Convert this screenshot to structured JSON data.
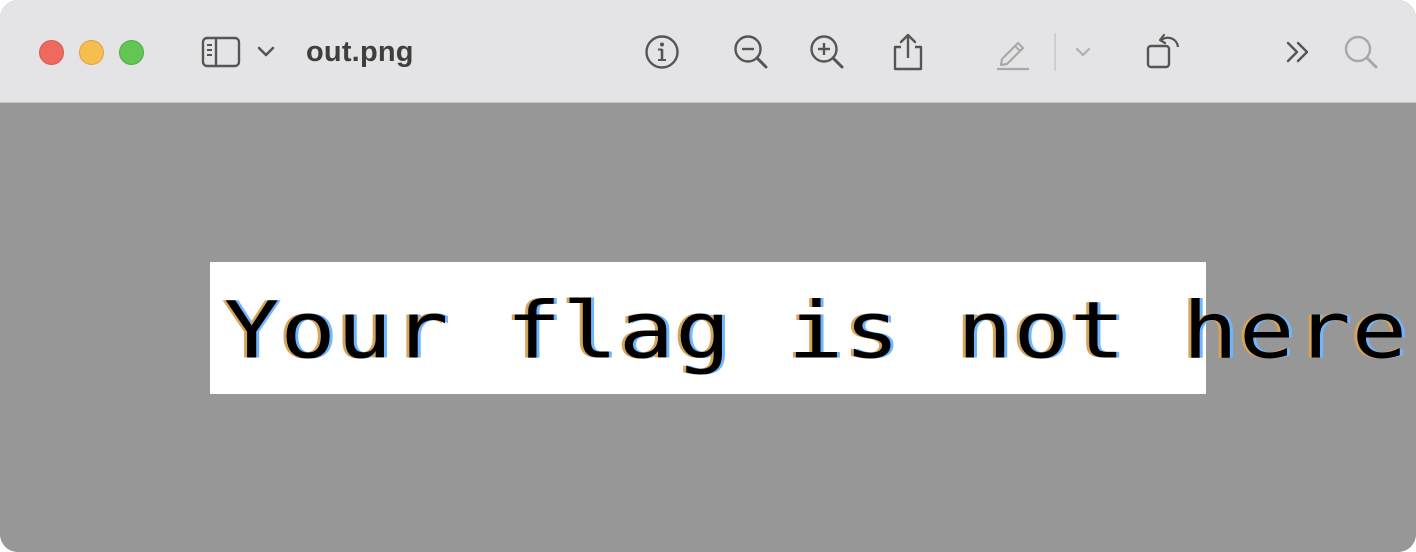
{
  "window": {
    "title": "out.png"
  },
  "toolbar": {
    "icons": [
      "sidebar-toggle-icon",
      "chevron-down-icon",
      "info-icon",
      "zoom-out-icon",
      "zoom-in-icon",
      "share-icon",
      "markup-pen-icon",
      "chevron-down-icon",
      "rotate-icon",
      "more-chevrons-icon",
      "search-icon"
    ]
  },
  "image": {
    "text": "Your flag is not here"
  },
  "colors": {
    "titlebar": "#e4e4e6",
    "canvas_background": "#979797",
    "close": "#ee6a5e",
    "minimize": "#f5be4f",
    "maximize": "#62c554"
  }
}
